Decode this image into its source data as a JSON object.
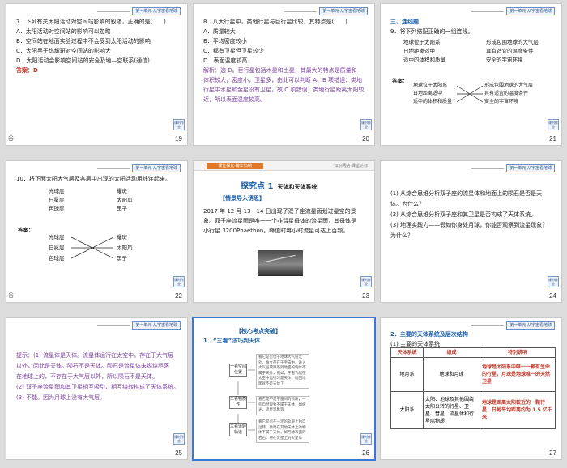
{
  "common": {
    "badge": "第一单元 从宇宙看地球",
    "return": "课时作业",
    "edge_mark": "谷"
  },
  "slides": {
    "s19": {
      "number": "19",
      "lines": [
        "7．下列有关太阳活动对空间站影响的叙述，正确的是(　　)",
        "A．太阳活动对空间站的影响可以忽略",
        "B．空间站在地面实验过程中不会受到太阳活动的影响",
        "C．太阳黑子比耀斑对空间站的影响大",
        "D．太阳活动会影响空间站的安全及地—空联系(通信)"
      ],
      "answer_label": "答案：",
      "answer_value": "D"
    },
    "s20": {
      "number": "20",
      "lines": [
        "8．八大行星中，类地行星与巨行星比较，其特点是(　　)",
        "A．质量较大",
        "B．平均密度较小",
        "C．都有卫星但卫星较少",
        "D．表面温度较高"
      ],
      "analysis": [
        "解析：选 D。巨行星包括木星和土星，其最大的特点是质量和",
        "体积较大，密度小，卫星多，由此可以判断 A、B 项错误；类地",
        "行星中水星和金星没有卫星，故 C 项错误；类地行星距离太阳较",
        "近，所以表面温度较高。"
      ]
    },
    "s21": {
      "number": "21",
      "section": "三、连线题",
      "question": "9．将下列搭配正确的一组连线。",
      "left": [
        "地球位于太阳系",
        "日地距离适中",
        "适中的体积和质量"
      ],
      "right": [
        "形成包围地球的大气层",
        "具有适宜的温度条件",
        "安全的宇宙环境"
      ],
      "answer_label": "答案：",
      "a_left": [
        "地球位于太阳系",
        "日地距离适中",
        "适中的体积和质量"
      ],
      "a_right": [
        "形成包围地球的大气层",
        "具有适宜的温度条件",
        "安全的宇宙环境"
      ]
    },
    "s22": {
      "number": "22",
      "question": "10．将下面太阳大气层及各层中出现的太阳活动用线连起来。",
      "left": [
        "光球层",
        "日冕层",
        "色球层"
      ],
      "right": [
        "耀斑",
        "太阳风",
        "黑子"
      ],
      "answer_label": "答案：",
      "a_left": [
        "光球层",
        "日冕层",
        "色球层"
      ],
      "a_right": [
        "耀斑",
        "太阳风",
        "黑子"
      ]
    },
    "s23": {
      "number": "23",
      "header_tag": "课堂探究·精华归纳",
      "header_right": "知识网络·课堂达标",
      "title": "探究点 1",
      "title_small": "天体和天体系统",
      "subtitle": "【情景导入诱思】",
      "lines": [
        "2017 年 12 月 13－14 日出现了双子座流星雨划过星空的景",
        "象。双子座流星雨是唯一一个非彗星母体的流星雨，其母体是",
        "小行星 3200Phaethon。峰值时每小时流星可达上百颗。"
      ]
    },
    "s24": {
      "number": "24",
      "lines": [
        "(1) 从综合思维分析双子座的流星体和地面上的陨石是否是天",
        "体。为什么？",
        "(2) 从综合思维分析双子座和其卫星是否构成了天体系统。",
        "(3) 地理实践力——假如你身处月球，你能否观察到流星现象？",
        "为什么？"
      ]
    },
    "s25": {
      "number": "25",
      "lines": [
        "提示：(1) 流星体是天体。流星体运行在太空中，存在于大气层",
        "以外，因此是天体。陨石不是天体。陨石是流星体未燃烧尽落",
        "在地球上的，不存在于大气层以外，所以陨石不是天体。",
        "(2) 双子座流星雨和其卫星相互吸引、相互绕转构成了天体系统。",
        "(3) 不能。因为月球上没有大气层。"
      ]
    },
    "s26": {
      "number": "26",
      "title": "【核心考点突破】",
      "subtitle": "1．“三看”法巧判天体",
      "steps": [
        "一看空间位置",
        "二看物质性",
        "三看运转轨道"
      ],
      "descriptions": [
        "看它是否位于地球大气层之外，独立存在于宇宙中。进入大气层或降落到地面的物体不属于天体，例如，宇宙飞船在太空中运行时是天体，返回地面就不是天体了",
        "看它是不是宇宙间的物质，一些自然现象不属于天体，如极光、流星现象等",
        "看它是否在一定的轨道上独自运转。依附在其他天体上的物体不属于天体，如月球表面的岩石，待在火星上的火星车"
      ]
    },
    "s27": {
      "number": "27",
      "heading": "2．主要的天体系统及层次结构",
      "sub": "(1) 主要的天体系统",
      "headers": [
        "天体系统",
        "组成",
        "特别说明"
      ],
      "rows": [
        [
          "地月系",
          "地球和月球",
          "地球是太阳系中唯一一颗有生命的行星，月球是地球唯一的天然卫星"
        ],
        [
          "太阳系",
          "太阳、地球及其他围绕太阳公转的行星、卫星、彗星、流星体和行星际物质",
          "地球是距离太阳较近的一颗行星，日地平均距离约为 1.5 亿千米"
        ]
      ]
    }
  }
}
